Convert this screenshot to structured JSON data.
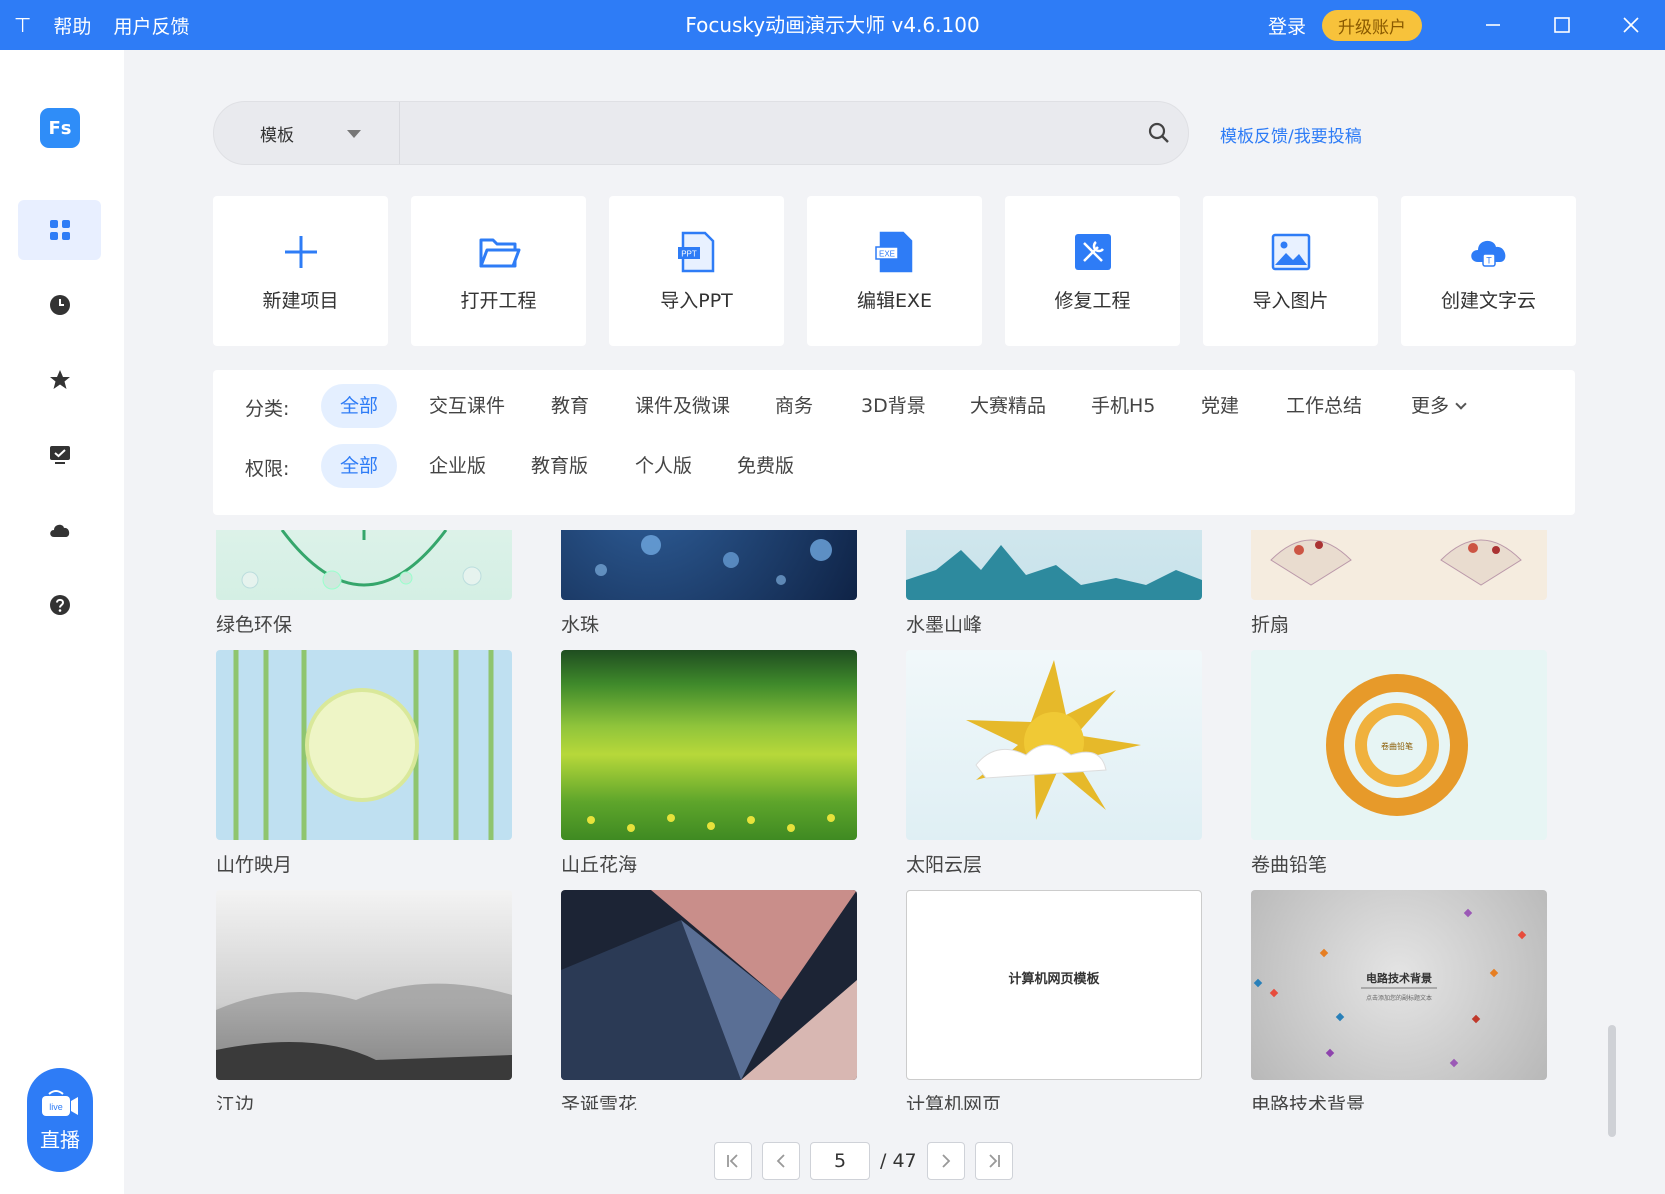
{
  "titlebar": {
    "app_glyph": "⊤",
    "help": "帮助",
    "feedback": "用户反馈",
    "title": "Focusky动画演示大师 v4.6.100",
    "login": "登录",
    "upgrade": "升级账户",
    "minimize": "—",
    "maximize": "☐",
    "close": "✕"
  },
  "sidebar": {
    "logo": "Fs",
    "items": [
      {
        "icon": "grid-icon",
        "active": true
      },
      {
        "icon": "clock-icon"
      },
      {
        "icon": "star-icon"
      },
      {
        "icon": "presentation-icon"
      },
      {
        "icon": "cloud-icon"
      },
      {
        "icon": "help-icon"
      }
    ],
    "live_badge": "live",
    "live_label": "直播"
  },
  "search": {
    "category": "模板",
    "placeholder": "",
    "feedback_link": "模板反馈/我要投稿"
  },
  "actions": [
    {
      "label": "新建项目",
      "icon": "plus-icon"
    },
    {
      "label": "打开工程",
      "icon": "folder-open-icon"
    },
    {
      "label": "导入PPT",
      "icon": "ppt-file-icon"
    },
    {
      "label": "编辑EXE",
      "icon": "exe-file-icon"
    },
    {
      "label": "修复工程",
      "icon": "repair-tools-icon"
    },
    {
      "label": "导入图片",
      "icon": "image-icon"
    },
    {
      "label": "创建文字云",
      "icon": "word-cloud-icon"
    }
  ],
  "filters": {
    "category_label": "分类:",
    "categories": [
      "全部",
      "交互课件",
      "教育",
      "课件及微课",
      "商务",
      "3D背景",
      "大赛精品",
      "手机H5",
      "党建",
      "工作总结"
    ],
    "more": "更多",
    "permission_label": "权限:",
    "permissions": [
      "全部",
      "企业版",
      "教育版",
      "个人版",
      "免费版"
    ]
  },
  "templates": [
    {
      "name": "绿色环保"
    },
    {
      "name": "水珠"
    },
    {
      "name": "水墨山峰"
    },
    {
      "name": "折扇"
    },
    {
      "name": "山竹映月"
    },
    {
      "name": "山丘花海"
    },
    {
      "name": "太阳云层"
    },
    {
      "name": "卷曲铅笔",
      "thumb_text": "卷曲铅笔"
    },
    {
      "name": "江边"
    },
    {
      "name": "圣诞雪花"
    },
    {
      "name": "计算机网页",
      "thumb_text": "计算机网页模板"
    },
    {
      "name": "电路技术背景",
      "thumb_text": "电路技术背景",
      "thumb_sub": "点击添加您的副标题文本"
    }
  ],
  "pagination": {
    "current": "5",
    "total": "/ 47"
  },
  "colors": {
    "accent": "#2e7cf6",
    "upgrade": "#f7c23b"
  }
}
